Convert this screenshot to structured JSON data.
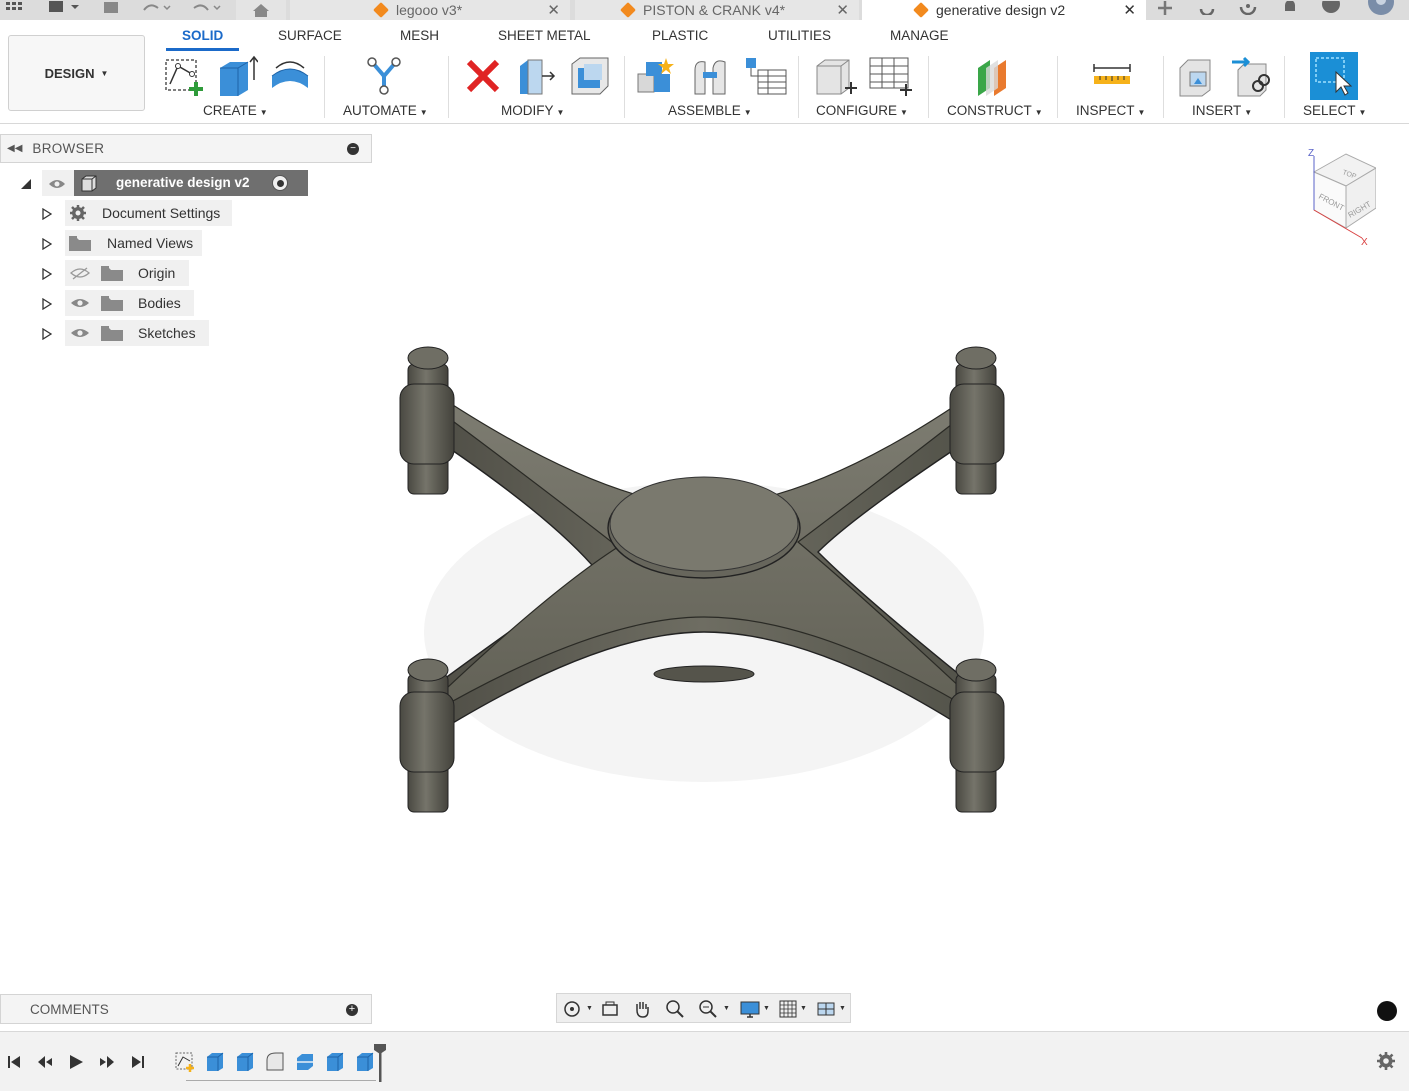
{
  "tabs": [
    {
      "label": "legooo v3*",
      "active": false
    },
    {
      "label": "PISTON & CRANK v4*",
      "active": false
    },
    {
      "label": "generative design v2",
      "active": true
    }
  ],
  "workspace": {
    "label": "DESIGN"
  },
  "ribbon_tabs": [
    "SOLID",
    "SURFACE",
    "MESH",
    "SHEET METAL",
    "PLASTIC",
    "UTILITIES",
    "MANAGE"
  ],
  "groups": {
    "create": "CREATE",
    "automate": "AUTOMATE",
    "modify": "MODIFY",
    "assemble": "ASSEMBLE",
    "configure": "CONFIGURE",
    "construct": "CONSTRUCT",
    "inspect": "INSPECT",
    "insert": "INSERT",
    "select": "SELECT"
  },
  "browser": {
    "title": "BROWSER",
    "root": "generative design v2",
    "items": [
      "Document Settings",
      "Named Views",
      "Origin",
      "Bodies",
      "Sketches"
    ]
  },
  "comments": {
    "title": "COMMENTS"
  },
  "viewcube": {
    "top": "TOP",
    "front": "FRONT",
    "right": "RIGHT",
    "z": "Z",
    "x": "X"
  },
  "colors": {
    "accent": "#1b6ac9",
    "brand_orange": "#f28a1e",
    "model": "#6b6a5f",
    "select_blue": "#1b8fd6"
  }
}
